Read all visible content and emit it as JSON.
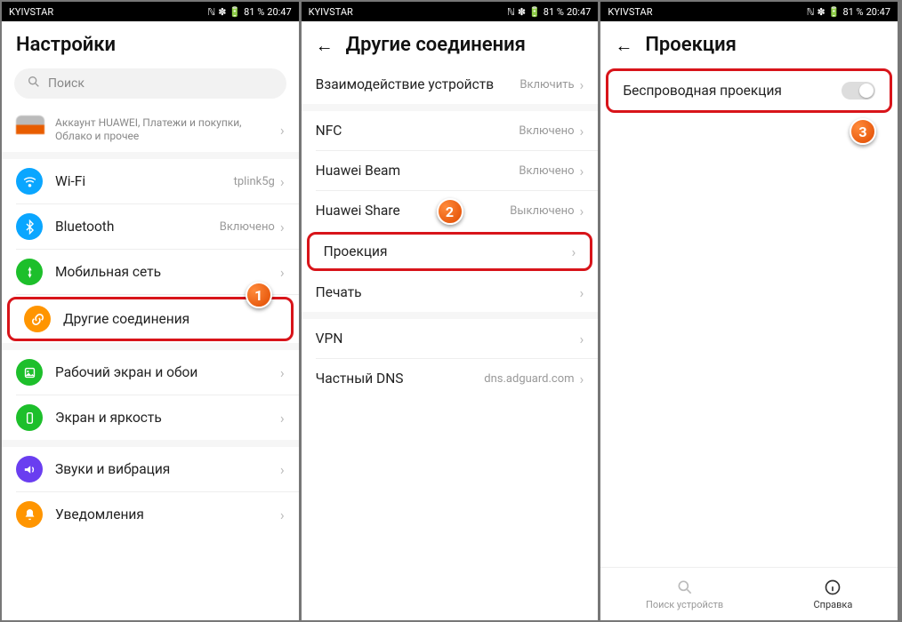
{
  "status": {
    "carrier": "KYIVSTAR",
    "battery": "81 %",
    "time": "20:47"
  },
  "panel1": {
    "title": "Настройки",
    "search_placeholder": "Поиск",
    "account_sub": "Аккаунт HUAWEI, Платежи и покупки, Облако и прочее",
    "items": [
      {
        "label": "Wi-Fi",
        "value": "tplink5g"
      },
      {
        "label": "Bluetooth",
        "value": "Включено"
      },
      {
        "label": "Мобильная сеть",
        "value": ""
      },
      {
        "label": "Другие соединения",
        "value": ""
      },
      {
        "label": "Рабочий экран и обои",
        "value": ""
      },
      {
        "label": "Экран и яркость",
        "value": ""
      },
      {
        "label": "Звуки и вибрация",
        "value": ""
      },
      {
        "label": "Уведомления",
        "value": ""
      }
    ],
    "callout": "1"
  },
  "panel2": {
    "title": "Другие соединения",
    "items": [
      {
        "label": "Взаимодействие устройств",
        "value": "Включить"
      },
      {
        "label": "NFC",
        "value": "Включено"
      },
      {
        "label": "Huawei Beam",
        "value": "Включено"
      },
      {
        "label": "Huawei Share",
        "value": "Выключено"
      },
      {
        "label": "Проекция",
        "value": ""
      },
      {
        "label": "Печать",
        "value": ""
      },
      {
        "label": "VPN",
        "value": ""
      },
      {
        "label": "Частный DNS",
        "value": "dns.adguard.com"
      }
    ],
    "callout": "2"
  },
  "panel3": {
    "title": "Проекция",
    "toggle_label": "Беспроводная проекция",
    "callout": "3",
    "bottom": {
      "search": "Поиск устройств",
      "help": "Справка"
    }
  },
  "colors": {
    "wifi": "#0aa6ff",
    "bt": "#0aa6ff",
    "mobile": "#1dbf2b",
    "other": "#ff9500",
    "screen": "#1dbf2b",
    "bright": "#1dbf2b",
    "sound": "#6a3ef0",
    "notif": "#ff9500"
  }
}
